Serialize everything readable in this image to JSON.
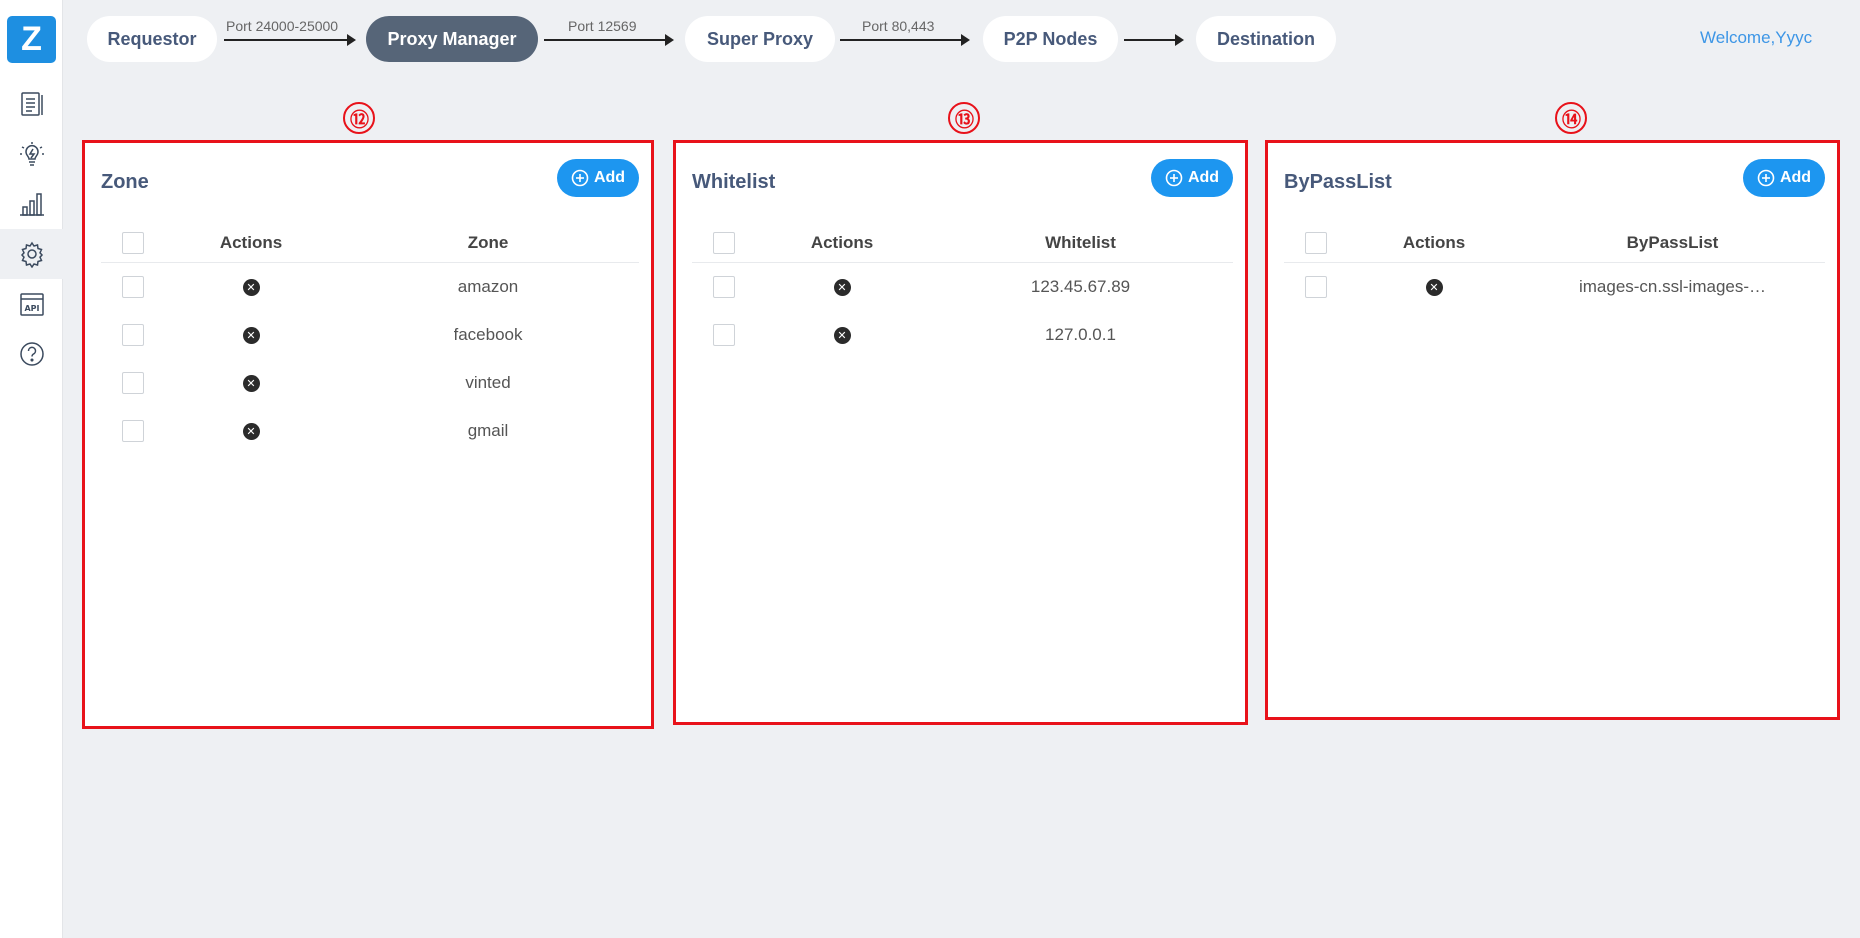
{
  "app": {
    "logo_letter": "Z"
  },
  "sidebar": {
    "items": [
      {
        "icon": "document-list-icon",
        "label": "Logs"
      },
      {
        "icon": "lightbulb-icon",
        "label": "Tips"
      },
      {
        "icon": "bar-chart-icon",
        "label": "Statistics"
      },
      {
        "icon": "gear-icon",
        "label": "Settings",
        "active": true
      },
      {
        "icon": "api-window-icon",
        "label": "API",
        "text": "API"
      },
      {
        "icon": "help-circle-icon",
        "label": "Help"
      }
    ]
  },
  "flow": {
    "nodes": [
      "Requestor",
      "Proxy Manager",
      "Super Proxy",
      "P2P Nodes",
      "Destination"
    ],
    "active_node": "Proxy Manager",
    "ports": [
      "Port 24000-25000",
      "Port 12569",
      "Port 80,443",
      ""
    ]
  },
  "header": {
    "welcome": "Welcome,Yyyc"
  },
  "badges": [
    "⑫",
    "⑬",
    "⑭"
  ],
  "colors": {
    "accent": "#1d96f0",
    "highlight_border": "#e8121a",
    "active_pill": "#566578",
    "title": "#47597a"
  },
  "panels": [
    {
      "title": "Zone",
      "add_label": "Add",
      "columns": [
        "Actions",
        "Zone"
      ],
      "rows": [
        "amazon",
        "facebook",
        "vinted",
        "gmail"
      ]
    },
    {
      "title": "Whitelist",
      "add_label": "Add",
      "columns": [
        "Actions",
        "Whitelist"
      ],
      "rows": [
        "123.45.67.89",
        "127.0.0.1"
      ]
    },
    {
      "title": "ByPassList",
      "add_label": "Add",
      "columns": [
        "Actions",
        "ByPassList"
      ],
      "rows": [
        "images-cn.ssl-images-…"
      ]
    }
  ]
}
